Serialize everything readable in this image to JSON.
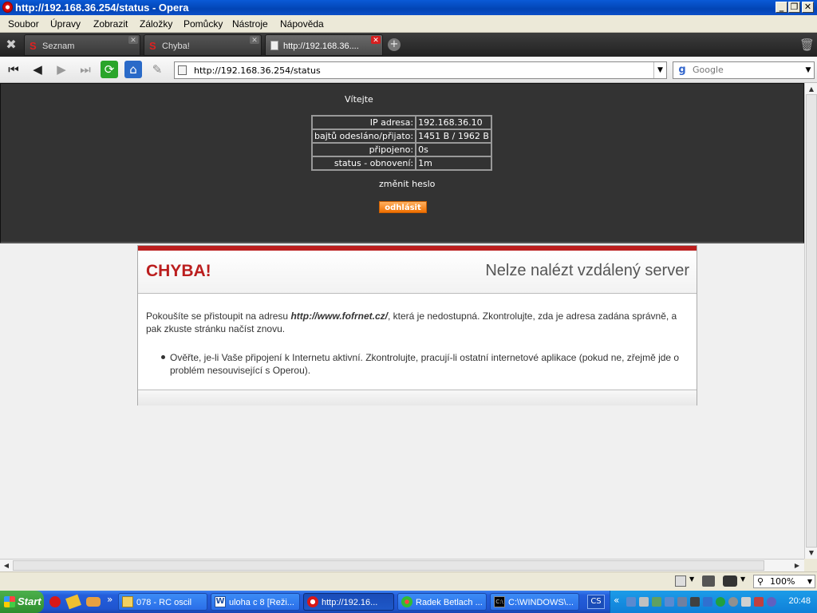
{
  "window": {
    "title": "http://192.168.36.254/status - Opera"
  },
  "menu": [
    "Soubor",
    "Úpravy",
    "Zobrazit",
    "Záložky",
    "Pomůcky",
    "Nástroje",
    "Nápověda"
  ],
  "tabs": [
    {
      "label": "Seznam"
    },
    {
      "label": "Chyba!"
    },
    {
      "label": "http://192.168.36...."
    }
  ],
  "address": {
    "url": "http://192.168.36.254/status"
  },
  "search": {
    "placeholder": "Google"
  },
  "status_page": {
    "welcome": "Vítejte",
    "rows": [
      {
        "key": "IP adresa:",
        "value": "192.168.36.10"
      },
      {
        "key": "bajtů odesláno/přijato:",
        "value": "1451 B / 1962 B"
      },
      {
        "key": "připojeno:",
        "value": "0s"
      },
      {
        "key": "status - obnovení:",
        "value": "1m"
      }
    ],
    "change_password": "změnit heslo",
    "logout": "odhlásit"
  },
  "error": {
    "title": "CHYBA!",
    "subtitle": "Nelze nalézt vzdálený server",
    "body_pre": "Pokoušíte se přistoupit na adresu ",
    "body_url": "http://www.fofrnet.cz/",
    "body_post": ", která je nedostupná. Zkontrolujte, zda je adresa zadána správně, a pak zkuste stránku načíst znovu.",
    "bullet": "Ověřte, je-li Vaše připojení k Internetu aktivní. Zkontrolujte, pracují-li ostatní internetové aplikace (pokud ne, zřejmě jde o problém nesouvisející s Operou)."
  },
  "statusbar": {
    "zoom": "100%"
  },
  "taskbar": {
    "start": "Start",
    "buttons": [
      {
        "label": "078 - RC oscil",
        "icon": "folder-icon"
      },
      {
        "label": "uloha c 8 [Reži...",
        "icon": "word-icon"
      },
      {
        "label": "http://192.16...",
        "icon": "opera-icon"
      },
      {
        "label": "Radek Betlach ...",
        "icon": "icq-icon"
      },
      {
        "label": "C:\\WINDOWS\\...",
        "icon": "console-icon"
      }
    ],
    "lang": "CS",
    "clock": "20:48"
  },
  "colors": {
    "accent_red": "#bb1e1e",
    "logout_orange": "#f07000",
    "dark_bg": "#333333"
  }
}
